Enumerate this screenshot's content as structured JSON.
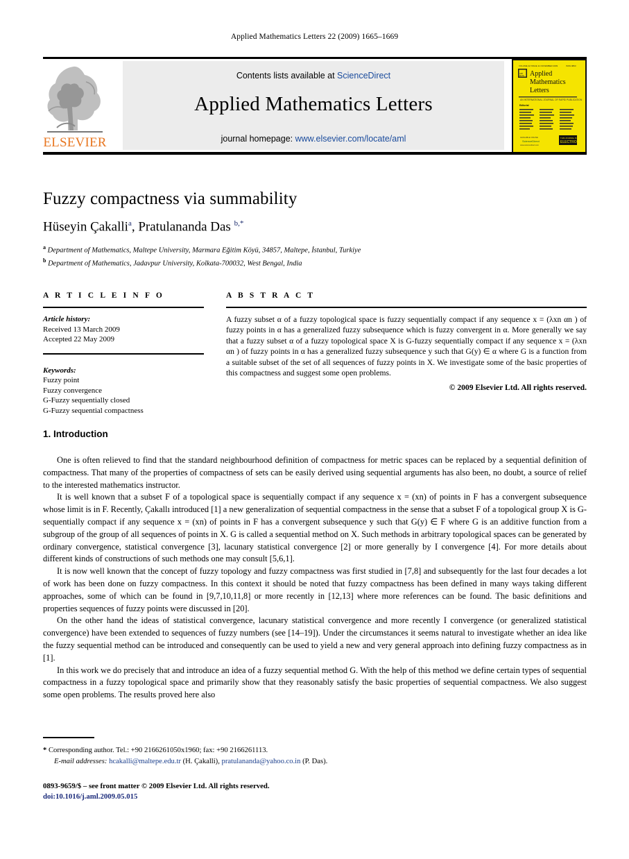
{
  "running_head": "Applied Mathematics Letters 22 (2009) 1665–1669",
  "masthead": {
    "contents_prefix": "Contents lists available at ",
    "sciencedirect": "ScienceDirect",
    "journal_name": "Applied Mathematics Letters",
    "homepage_prefix": "journal homepage: ",
    "homepage_url": "www.elsevier.com/locate/aml",
    "publisher_wordmark": "ELSEVIER",
    "cover": {
      "line1": "Applied",
      "line2": "Mathematics",
      "line3": "Letters",
      "background_color": "#F5E400"
    }
  },
  "article": {
    "title": "Fuzzy compactness via summability",
    "authors_html": "Hüseyin Çakalli",
    "author1": "Hüseyin Çakalli",
    "author1_mark": "a",
    "author2": "Pratulananda Das",
    "author2_mark": "b,*",
    "affiliation_a_mark": "a",
    "affiliation_a": "Department of Mathematics, Maltepe University, Marmara Eğitim Köyü, 34857, Maltepe, İstanbul, Turkiye",
    "affiliation_b_mark": "b",
    "affiliation_b": "Department of Mathematics, Jadavpur University, Kolkata-700032, West Bengal, India"
  },
  "article_info": {
    "heading": "A R T I C L E    I N F O",
    "history_label": "Article history:",
    "received": "Received 13 March 2009",
    "accepted": "Accepted 22 May 2009",
    "keywords_label": "Keywords:",
    "keywords": [
      "Fuzzy point",
      "Fuzzy convergence",
      "G-Fuzzy sequentially closed",
      "G-Fuzzy sequential compactness"
    ]
  },
  "abstract": {
    "heading": "A B S T R A C T",
    "text": "A fuzzy subset α of a fuzzy topological space is fuzzy sequentially compact if any sequence x = (λxn αn ) of fuzzy points in α has a generalized fuzzy subsequence which is fuzzy convergent in α. More generally we say that a fuzzy subset α of a fuzzy topological space X is G-fuzzy sequentially compact if any sequence x = (λxn αn ) of fuzzy points in α has a generalized fuzzy subsequence y such that G(y) ∈ α where G is a function from a suitable subset of the set of all sequences of fuzzy points in X. We investigate some of the basic properties of this compactness and suggest some open problems.",
    "copyright": "© 2009 Elsevier Ltd. All rights reserved."
  },
  "section": {
    "number_title": "1. Introduction",
    "paragraphs": [
      "One is often relieved to find that the standard neighbourhood definition of compactness for metric spaces can be replaced by a sequential definition of compactness. That many of the properties of compactness of sets can be easily derived using sequential arguments has also been, no doubt, a source of relief to the interested mathematics instructor.",
      "It is well known that a subset F of a topological space is sequentially compact if any sequence x = (xn) of points in F has a convergent subsequence whose limit is in F. Recently, Çakallı introduced [1] a new generalization of sequential compactness in the sense that a subset F of a topological group X is G-sequentially compact if any sequence x = (xn) of points in F has a convergent subsequence y such that G(y) ∈ F where G is an additive function from a subgroup of the group of all sequences of points in X. G is called a sequential method on X. Such methods in arbitrary topological spaces can be generated by ordinary convergence, statistical convergence [3], lacunary statistical convergence [2] or more generally by I convergence [4]. For more details about different kinds of constructions of such methods one may consult [5,6,1].",
      "It is now well known that the concept of fuzzy topology and fuzzy compactness was first studied in [7,8] and subsequently for the last four decades a lot of work has been done on fuzzy compactness. In this context it should be noted that fuzzy compactness has been defined in many ways taking different approaches, some of which can be found in [9,7,10,11,8] or more recently in [12,13] where more references can be found. The basic definitions and properties sequences of fuzzy points were discussed in [20].",
      "On the other hand the ideas of statistical convergence, lacunary statistical convergence and more recently I convergence (or generalized statistical convergence) have been extended to sequences of fuzzy numbers (see [14–19]). Under the circumstances it seems natural to investigate whether an idea like the fuzzy sequential method can be introduced and consequently can be used to yield a new and very general approach into defining fuzzy compactness as in [1].",
      "In this work we do precisely that and introduce an idea of a fuzzy sequential method G. With the help of this method we define certain types of sequential compactness in a fuzzy topological space and primarily show that they reasonably satisfy the basic properties of sequential compactness. We also suggest some open problems. The results proved here also"
    ]
  },
  "footnotes": {
    "star": "*",
    "corresponding": "Corresponding author. Tel.: +90 2166261050x1960; fax: +90 2166261113.",
    "email_label": "E-mail addresses:",
    "email1": "hcakalli@maltepe.edu.tr",
    "email1_author": "(H. Çakalli),",
    "email2": "pratulananda@yahoo.co.in",
    "email2_author": "(P. Das)."
  },
  "imprint": {
    "issn_line": "0893-9659/$ – see front matter © 2009 Elsevier Ltd. All rights reserved.",
    "doi": "doi:10.1016/j.aml.2009.05.015"
  }
}
